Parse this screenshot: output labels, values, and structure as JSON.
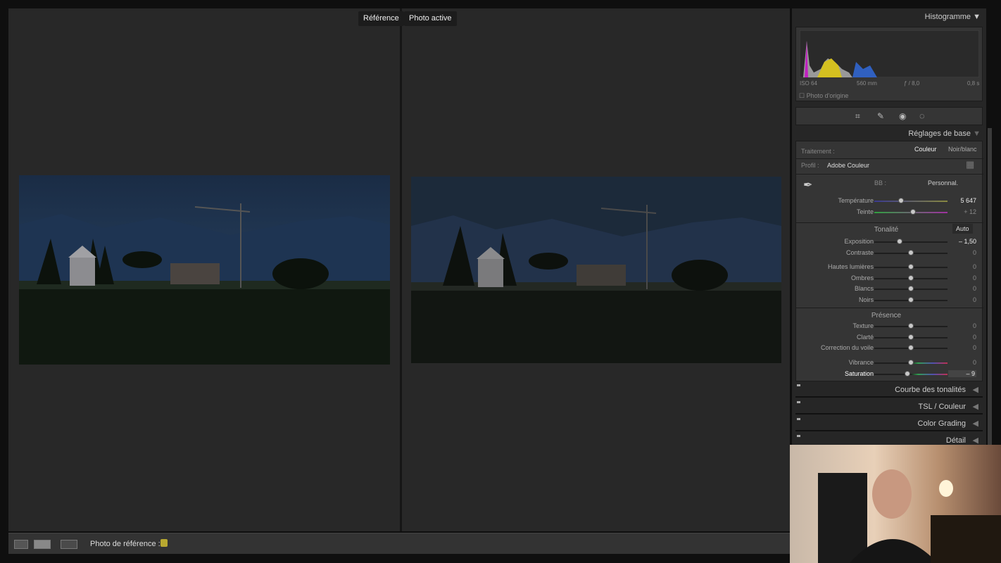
{
  "compare": {
    "reference_label": "Référence",
    "active_label": "Photo active"
  },
  "toolbar": {
    "reference_photo_label": "Photo de référence :",
    "view_icons": [
      "loupe-icon",
      "before-after-icon",
      "swap-icon"
    ],
    "lock_icon": "lock-icon"
  },
  "histogram": {
    "title": "Histogramme",
    "iso": "ISO 64",
    "focal": "560 mm",
    "aperture": "ƒ / 8,0",
    "shutter": "0,8 s",
    "original_photo_label": "Photo d'origine"
  },
  "tools": [
    "crop-icon",
    "healing-icon",
    "red-eye-icon",
    "mask-icon"
  ],
  "basic": {
    "title": "Réglages de base",
    "treatment_label": "Traitement :",
    "color": "Couleur",
    "bw": "Noir/blanc",
    "profile_label": "Profil :",
    "profile_value": "Adobe Couleur",
    "wb_label": "BB :",
    "wb_value": "Personnal.",
    "wb_sliders": [
      {
        "label": "Température",
        "value": "5 647",
        "pos": 0.37
      },
      {
        "label": "Teinte",
        "value": "+ 12",
        "pos": 0.53
      }
    ],
    "tone_title": "Tonalité",
    "auto": "Auto",
    "tone_sliders": [
      {
        "label": "Exposition",
        "value": "– 1,50",
        "pos": 0.35
      },
      {
        "label": "Contraste",
        "value": "0",
        "pos": 0.5
      },
      {
        "label": "Hautes lumières",
        "value": "0",
        "pos": 0.5
      },
      {
        "label": "Ombres",
        "value": "0",
        "pos": 0.5
      },
      {
        "label": "Blancs",
        "value": "0",
        "pos": 0.5
      },
      {
        "label": "Noirs",
        "value": "0",
        "pos": 0.5
      }
    ],
    "presence_title": "Présence",
    "presence_sliders": [
      {
        "label": "Texture",
        "value": "0",
        "pos": 0.5
      },
      {
        "label": "Clarté",
        "value": "0",
        "pos": 0.5
      },
      {
        "label": "Correction du voile",
        "value": "0",
        "pos": 0.5
      },
      {
        "label": "Vibrance",
        "value": "0",
        "pos": 0.5
      },
      {
        "label": "Saturation",
        "value": "– 9",
        "pos": 0.455
      }
    ]
  },
  "panels": [
    {
      "label": "Courbe des tonalités"
    },
    {
      "label": "TSL / Couleur"
    },
    {
      "label": "Color Grading"
    },
    {
      "label": "Détail"
    }
  ]
}
